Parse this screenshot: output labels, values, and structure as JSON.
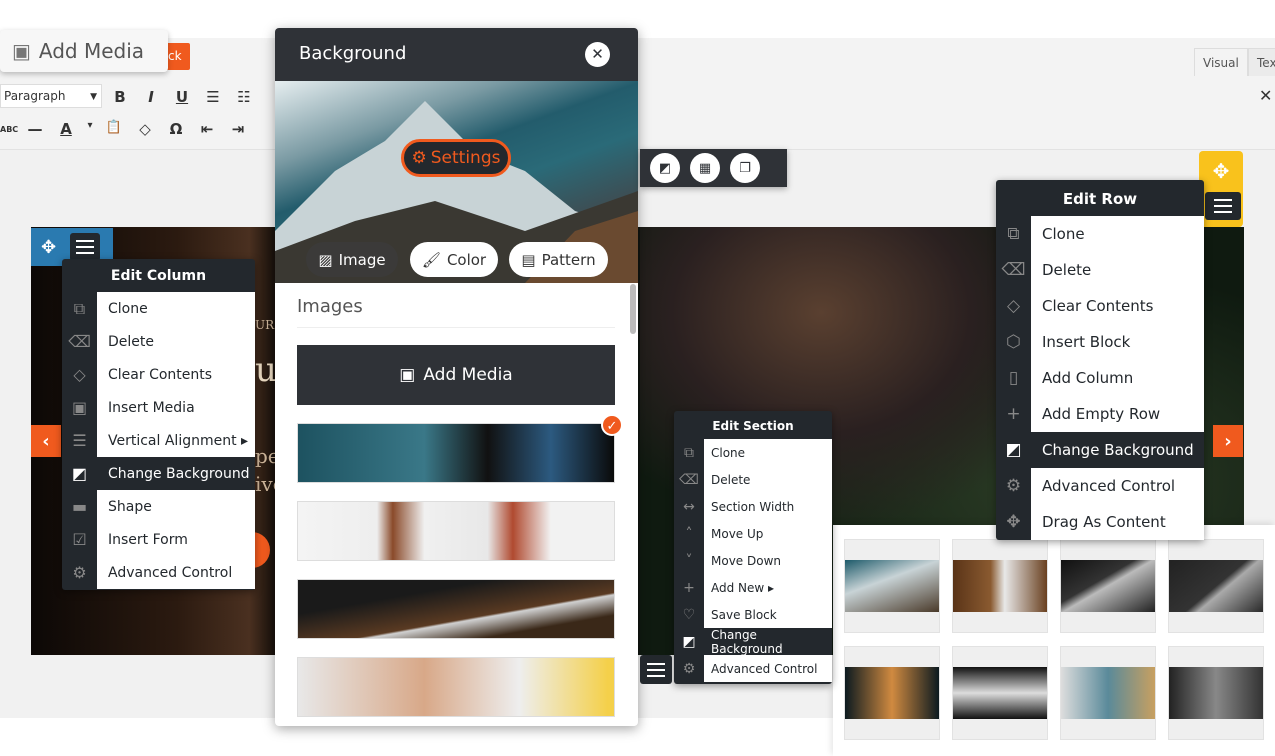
{
  "editor": {
    "add_media": "Add Media",
    "orange_button": "ck",
    "tabs": [
      "Visual",
      "Text"
    ],
    "format_select": "Paragraph",
    "toolbar_row1": [
      "B",
      "I",
      "U",
      "☰",
      "☷"
    ],
    "toolbar_row2": [
      "ABC",
      "—",
      "A",
      "▾",
      "📋",
      "◇",
      "Ω",
      "⇤",
      "⇥"
    ]
  },
  "hero": {
    "text_fragments": [
      "URS",
      "u",
      "pe",
      "ive"
    ]
  },
  "edit_column": {
    "title": "Edit Column",
    "items": [
      {
        "icon": "clone-icon",
        "glyph": "⧉",
        "label": "Clone"
      },
      {
        "icon": "delete-icon",
        "glyph": "⌫",
        "label": "Delete"
      },
      {
        "icon": "eraser-icon",
        "glyph": "◇",
        "label": "Clear Contents"
      },
      {
        "icon": "media-icon",
        "glyph": "▣",
        "label": "Insert Media"
      },
      {
        "icon": "align-icon",
        "glyph": "☰",
        "label": "Vertical Alignment ▸"
      },
      {
        "icon": "background-icon",
        "glyph": "◩",
        "label": "Change Background",
        "selected": true
      },
      {
        "icon": "shape-icon",
        "glyph": "▬",
        "label": "Shape"
      },
      {
        "icon": "form-icon",
        "glyph": "☑",
        "label": "Insert Form"
      },
      {
        "icon": "gear-icon",
        "glyph": "⚙",
        "label": "Advanced Control"
      }
    ]
  },
  "background_panel": {
    "title": "Background",
    "settings": "Settings",
    "tabs": [
      {
        "label": "Image",
        "icon": "image-icon",
        "active": true
      },
      {
        "label": "Color",
        "icon": "brush-icon"
      },
      {
        "label": "Pattern",
        "icon": "pattern-icon"
      }
    ],
    "images_title": "Images",
    "add_media": "Add Media"
  },
  "edit_row": {
    "title": "Edit Row",
    "items": [
      {
        "icon": "clone-icon",
        "glyph": "⧉",
        "label": "Clone"
      },
      {
        "icon": "delete-icon",
        "glyph": "⌫",
        "label": "Delete"
      },
      {
        "icon": "eraser-icon",
        "glyph": "◇",
        "label": "Clear Contents"
      },
      {
        "icon": "block-icon",
        "glyph": "⬡",
        "label": "Insert Block"
      },
      {
        "icon": "column-icon",
        "glyph": "▯",
        "label": "Add Column"
      },
      {
        "icon": "plus-icon",
        "glyph": "+",
        "label": "Add Empty Row"
      },
      {
        "icon": "background-icon",
        "glyph": "◩",
        "label": "Change Background",
        "selected": true
      },
      {
        "icon": "gear-icon",
        "glyph": "⚙",
        "label": "Advanced Control"
      },
      {
        "icon": "move-icon",
        "glyph": "✥",
        "label": "Drag As Content"
      }
    ]
  },
  "edit_section": {
    "title": "Edit Section",
    "items": [
      {
        "icon": "clone-icon",
        "glyph": "⧉",
        "label": "Clone"
      },
      {
        "icon": "delete-icon",
        "glyph": "⌫",
        "label": "Delete"
      },
      {
        "icon": "width-icon",
        "glyph": "↔",
        "label": "Section Width"
      },
      {
        "icon": "chevron-up-icon",
        "glyph": "˄",
        "label": "Move Up"
      },
      {
        "icon": "chevron-down-icon",
        "glyph": "˅",
        "label": "Move Down"
      },
      {
        "icon": "plus-icon",
        "glyph": "+",
        "label": "Add New ▸"
      },
      {
        "icon": "heart-icon",
        "glyph": "♡",
        "label": "Save Block"
      },
      {
        "icon": "background-icon",
        "glyph": "◩",
        "label": "Change Background",
        "selected": true
      },
      {
        "icon": "gear-icon",
        "glyph": "⚙",
        "label": "Advanced Control"
      }
    ]
  },
  "colors": {
    "accent": "#f05a1e",
    "column_handle": "#2a7ab0",
    "row_handle": "#f9c21c",
    "menu_dark": "#23282d"
  }
}
